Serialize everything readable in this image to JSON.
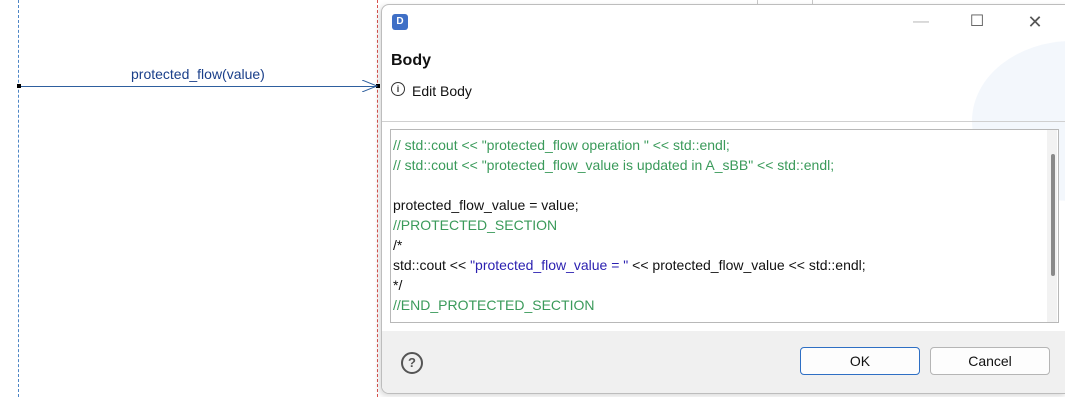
{
  "diagram": {
    "message_label": "protected_flow(value)"
  },
  "dialog": {
    "app_icon_text": "D",
    "window_controls": {
      "minimize": "—",
      "maximize": "☐",
      "close": "✕"
    },
    "header": {
      "title": "Body",
      "info_icon": "i",
      "description": "Edit Body"
    },
    "editor": {
      "lines": [
        [
          {
            "text": "// std::cout << \"protected_flow operation \" << std::endl;",
            "style": "comment"
          }
        ],
        [
          {
            "text": "// std::cout << \"protected_flow_value is updated in A_sBB\" << std::endl;",
            "style": "comment"
          }
        ],
        [
          {
            "text": "",
            "style": "plain"
          }
        ],
        [
          {
            "text": "protected_flow_value = value;",
            "style": "plain"
          }
        ],
        [
          {
            "text": "//PROTECTED_SECTION",
            "style": "comment"
          }
        ],
        [
          {
            "text": "/*",
            "style": "plain"
          }
        ],
        [
          {
            "text": "std::cout << ",
            "style": "plain"
          },
          {
            "text": "\"protected_flow_value = \"",
            "style": "string"
          },
          {
            "text": " << protected_flow_value << std::endl;",
            "style": "plain"
          }
        ],
        [
          {
            "text": "*/",
            "style": "plain"
          }
        ],
        [
          {
            "text": "//END_PROTECTED_SECTION",
            "style": "comment"
          }
        ]
      ]
    },
    "footer": {
      "help_icon": "?",
      "ok_label": "OK",
      "cancel_label": "Cancel"
    },
    "colors": {
      "comment": "#3a9a5a",
      "string": "#2a1fb0",
      "ok_border": "#2e6fc4"
    }
  }
}
